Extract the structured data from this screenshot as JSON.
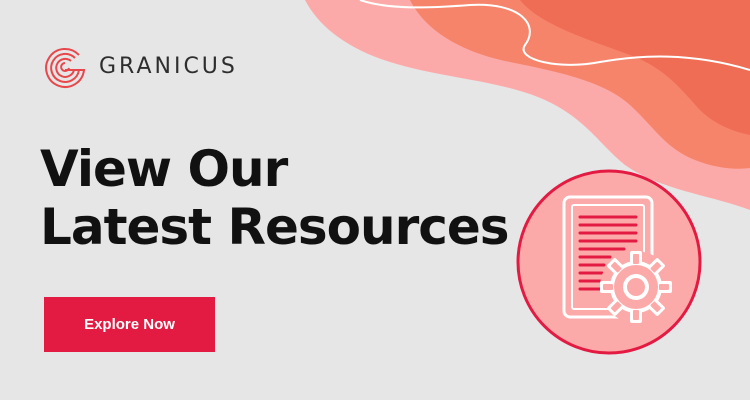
{
  "brand": {
    "name": "GRANICUS",
    "logo_icon": "granicus-g-logo-icon",
    "color": "#e8474c"
  },
  "headline": {
    "line1": "View Our",
    "line2": "Latest Resources"
  },
  "cta": {
    "label": "Explore Now",
    "color": "#e31b43"
  },
  "illustration": {
    "icon": "document-gear-icon",
    "circle_fill": "#fcaaa9",
    "circle_stroke": "#e31b43"
  },
  "colors": {
    "background": "#e6e6e6",
    "wave_light": "#fcaaa9",
    "wave_mid": "#f6846b",
    "wave_dark": "#ef6c55",
    "text": "#111111"
  }
}
